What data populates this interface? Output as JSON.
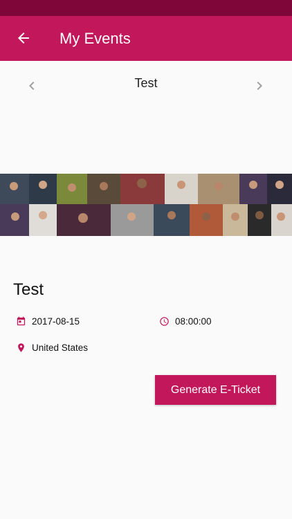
{
  "appbar": {
    "title": "My Events",
    "back_icon": "arrow-back-icon",
    "bg_color": "#c2185b",
    "status_color": "#7e0638"
  },
  "carousel": {
    "title": "Test",
    "prev_icon": "chevron-left-icon",
    "next_icon": "chevron-right-icon"
  },
  "event": {
    "title": "Test",
    "date": "2017-08-15",
    "time": "08:00:00",
    "location": "United States",
    "date_icon": "calendar-icon",
    "time_icon": "clock-icon",
    "location_icon": "location-pin-icon"
  },
  "actions": {
    "generate_ticket_label": "Generate E-Ticket"
  }
}
